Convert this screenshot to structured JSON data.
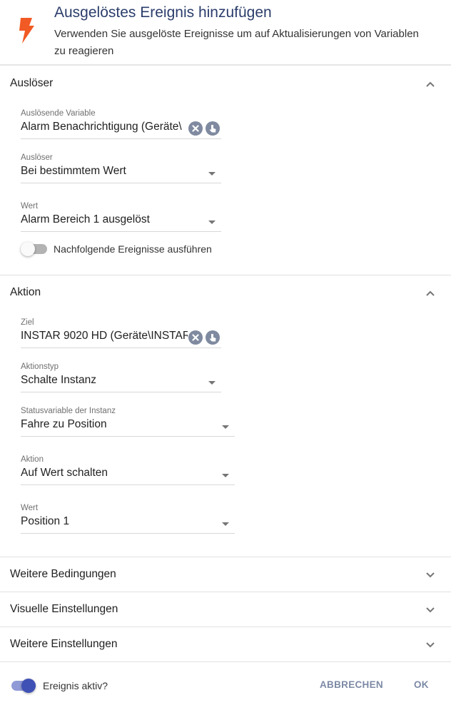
{
  "header": {
    "title": "Ausgelöstes Ereignis hinzufügen",
    "subtitle": "Verwenden Sie ausgelöste Ereignisse um auf Aktualisierungen von Variablen zu reagieren",
    "icon": "lightning-bolt-icon",
    "icon_color": "#f15a24"
  },
  "trigger_section": {
    "title": "Auslöser",
    "variable": {
      "label": "Auslösende Variable",
      "value": "Alarm Benachrichtigung (Geräte\\"
    },
    "trigger": {
      "label": "Auslöser",
      "value": "Bei bestimmtem Wert"
    },
    "value": {
      "label": "Wert",
      "value": "Alarm Bereich 1 ausgelöst"
    },
    "subsequent_toggle": {
      "label": "Nachfolgende Ereignisse ausführen",
      "on": false
    }
  },
  "action_section": {
    "title": "Aktion",
    "target": {
      "label": "Ziel",
      "value": "INSTAR 9020 HD (Geräte\\INSTAR"
    },
    "action_type": {
      "label": "Aktionstyp",
      "value": "Schalte Instanz"
    },
    "status_variable": {
      "label": "Statusvariable der Instanz",
      "value": "Fahre zu Position"
    },
    "action": {
      "label": "Aktion",
      "value": "Auf Wert schalten"
    },
    "value": {
      "label": "Wert",
      "value": "Position 1"
    }
  },
  "collapsed_sections": [
    {
      "title": "Weitere Bedingungen"
    },
    {
      "title": "Visuelle Einstellungen"
    },
    {
      "title": "Weitere Einstellungen"
    }
  ],
  "footer": {
    "active_toggle": {
      "label": "Ereignis aktiv?",
      "on": true
    },
    "cancel_label": "ABBRECHEN",
    "ok_label": "OK"
  },
  "colors": {
    "accent": "#3f51b5",
    "accent_track": "#8f9ad6",
    "button_text": "#7d8aa6"
  }
}
